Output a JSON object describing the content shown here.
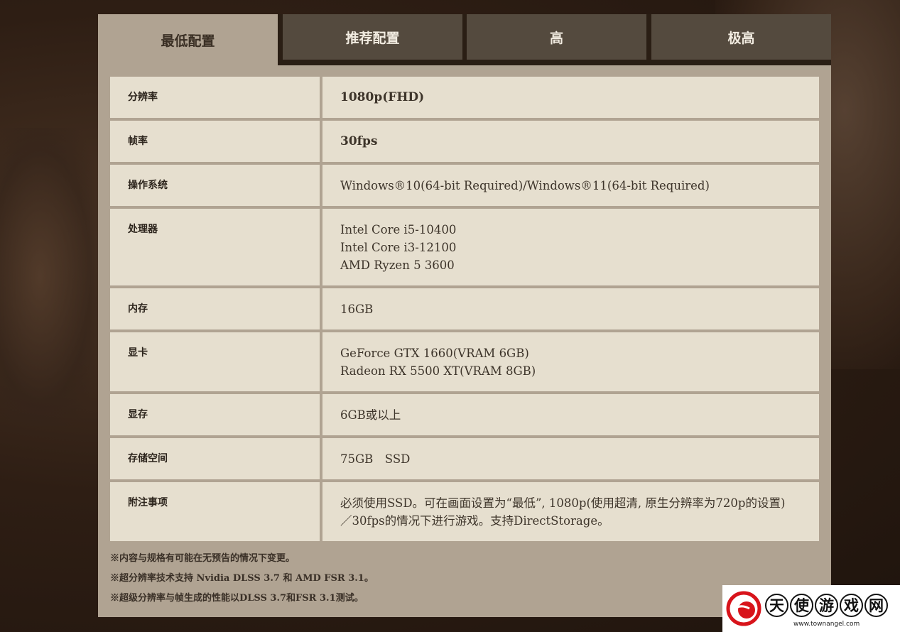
{
  "tabs": [
    {
      "label": "最低配置",
      "active": true
    },
    {
      "label": "推荐配置",
      "active": false
    },
    {
      "label": "高",
      "active": false
    },
    {
      "label": "极高",
      "active": false
    }
  ],
  "specs": [
    {
      "label": "分辨率",
      "lines": [
        "1080p(FHD)"
      ]
    },
    {
      "label": "帧率",
      "lines": [
        "30fps"
      ]
    },
    {
      "label": "操作系统",
      "lines": [
        "Windows®10(64-bit Required)/Windows®11(64-bit Required)"
      ]
    },
    {
      "label": "处理器",
      "lines": [
        "Intel Core i5-10400",
        "Intel Core i3-12100",
        "AMD Ryzen 5 3600"
      ]
    },
    {
      "label": "内存",
      "lines": [
        "16GB"
      ]
    },
    {
      "label": "显卡",
      "lines": [
        "GeForce GTX 1660(VRAM 6GB)",
        "Radeon RX 5500 XT(VRAM 8GB)"
      ]
    },
    {
      "label": "显存",
      "lines": [
        "6GB或以上"
      ]
    },
    {
      "label": "存储空间",
      "lines": [
        "75GB　SSD"
      ]
    },
    {
      "label": "附注事项",
      "lines": [
        "必须使用SSD。可在画面设置为“最低”, 1080p(使用超清, 原生分辨率为720p的设置)",
        "／30fps的情况下进行游戏。支持DirectStorage。"
      ]
    }
  ],
  "notes": [
    "※内容与规格有可能在无预告的情况下变更。",
    "※超分辨率技术支持 Nvidia DLSS 3.7 和 AMD FSR 3.1。",
    "※超级分辨率与帧生成的性能以DLSS 3.7和FSR 3.1测试。"
  ],
  "watermark": {
    "chars": [
      "天",
      "使",
      "游",
      "戏",
      "网"
    ],
    "url": "www.townangel.com"
  }
}
